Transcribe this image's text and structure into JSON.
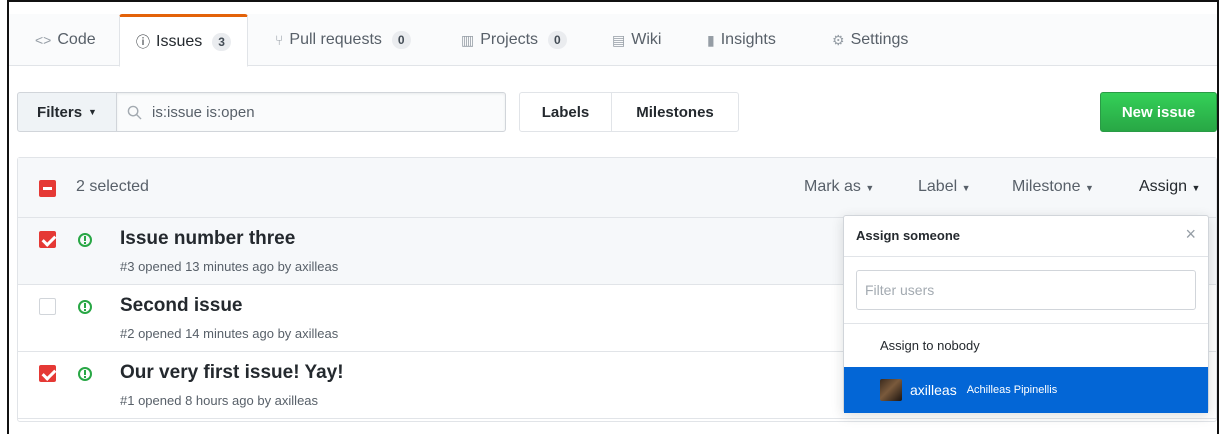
{
  "tabs": [
    {
      "icon": "code-icon",
      "glyph": "<>",
      "label": "Code",
      "count": null
    },
    {
      "icon": "issue-opened-icon",
      "glyph": "ⓘ",
      "label": "Issues",
      "count": "3"
    },
    {
      "icon": "git-pull-request-icon",
      "glyph": "⑂",
      "label": "Pull requests",
      "count": "0"
    },
    {
      "icon": "project-icon",
      "glyph": "▥",
      "label": "Projects",
      "count": "0"
    },
    {
      "icon": "book-icon",
      "glyph": "▤",
      "label": "Wiki",
      "count": null
    },
    {
      "icon": "graph-icon",
      "glyph": "▮",
      "label": "Insights",
      "count": null
    },
    {
      "icon": "gear-icon",
      "glyph": "⚙",
      "label": "Settings",
      "count": null
    }
  ],
  "toolbar": {
    "filters_label": "Filters",
    "search_value": "is:issue is:open",
    "labels_label": "Labels",
    "milestones_label": "Milestones",
    "new_issue_label": "New issue"
  },
  "header": {
    "selected_text": "2 selected",
    "mark_as": "Mark as",
    "label": "Label",
    "milestone": "Milestone",
    "assign": "Assign"
  },
  "issues": [
    {
      "title": "Issue number three",
      "meta": "#3 opened 13 minutes ago by axilleas",
      "checked": true
    },
    {
      "title": "Second issue",
      "meta": "#2 opened 14 minutes ago by axilleas",
      "checked": false
    },
    {
      "title": "Our very first issue! Yay!",
      "meta": "#1 opened 8 hours ago by axilleas",
      "checked": true
    }
  ],
  "assign_menu": {
    "title": "Assign someone",
    "filter_placeholder": "Filter users",
    "nobody_label": "Assign to nobody",
    "user_login": "axilleas",
    "user_name": "Achilleas Pipinellis"
  },
  "colors": {
    "accent_tab": "#e36209",
    "new_issue_green": "#28a745",
    "checkbox_red": "#e53935",
    "selected_blue": "#0366d6"
  }
}
